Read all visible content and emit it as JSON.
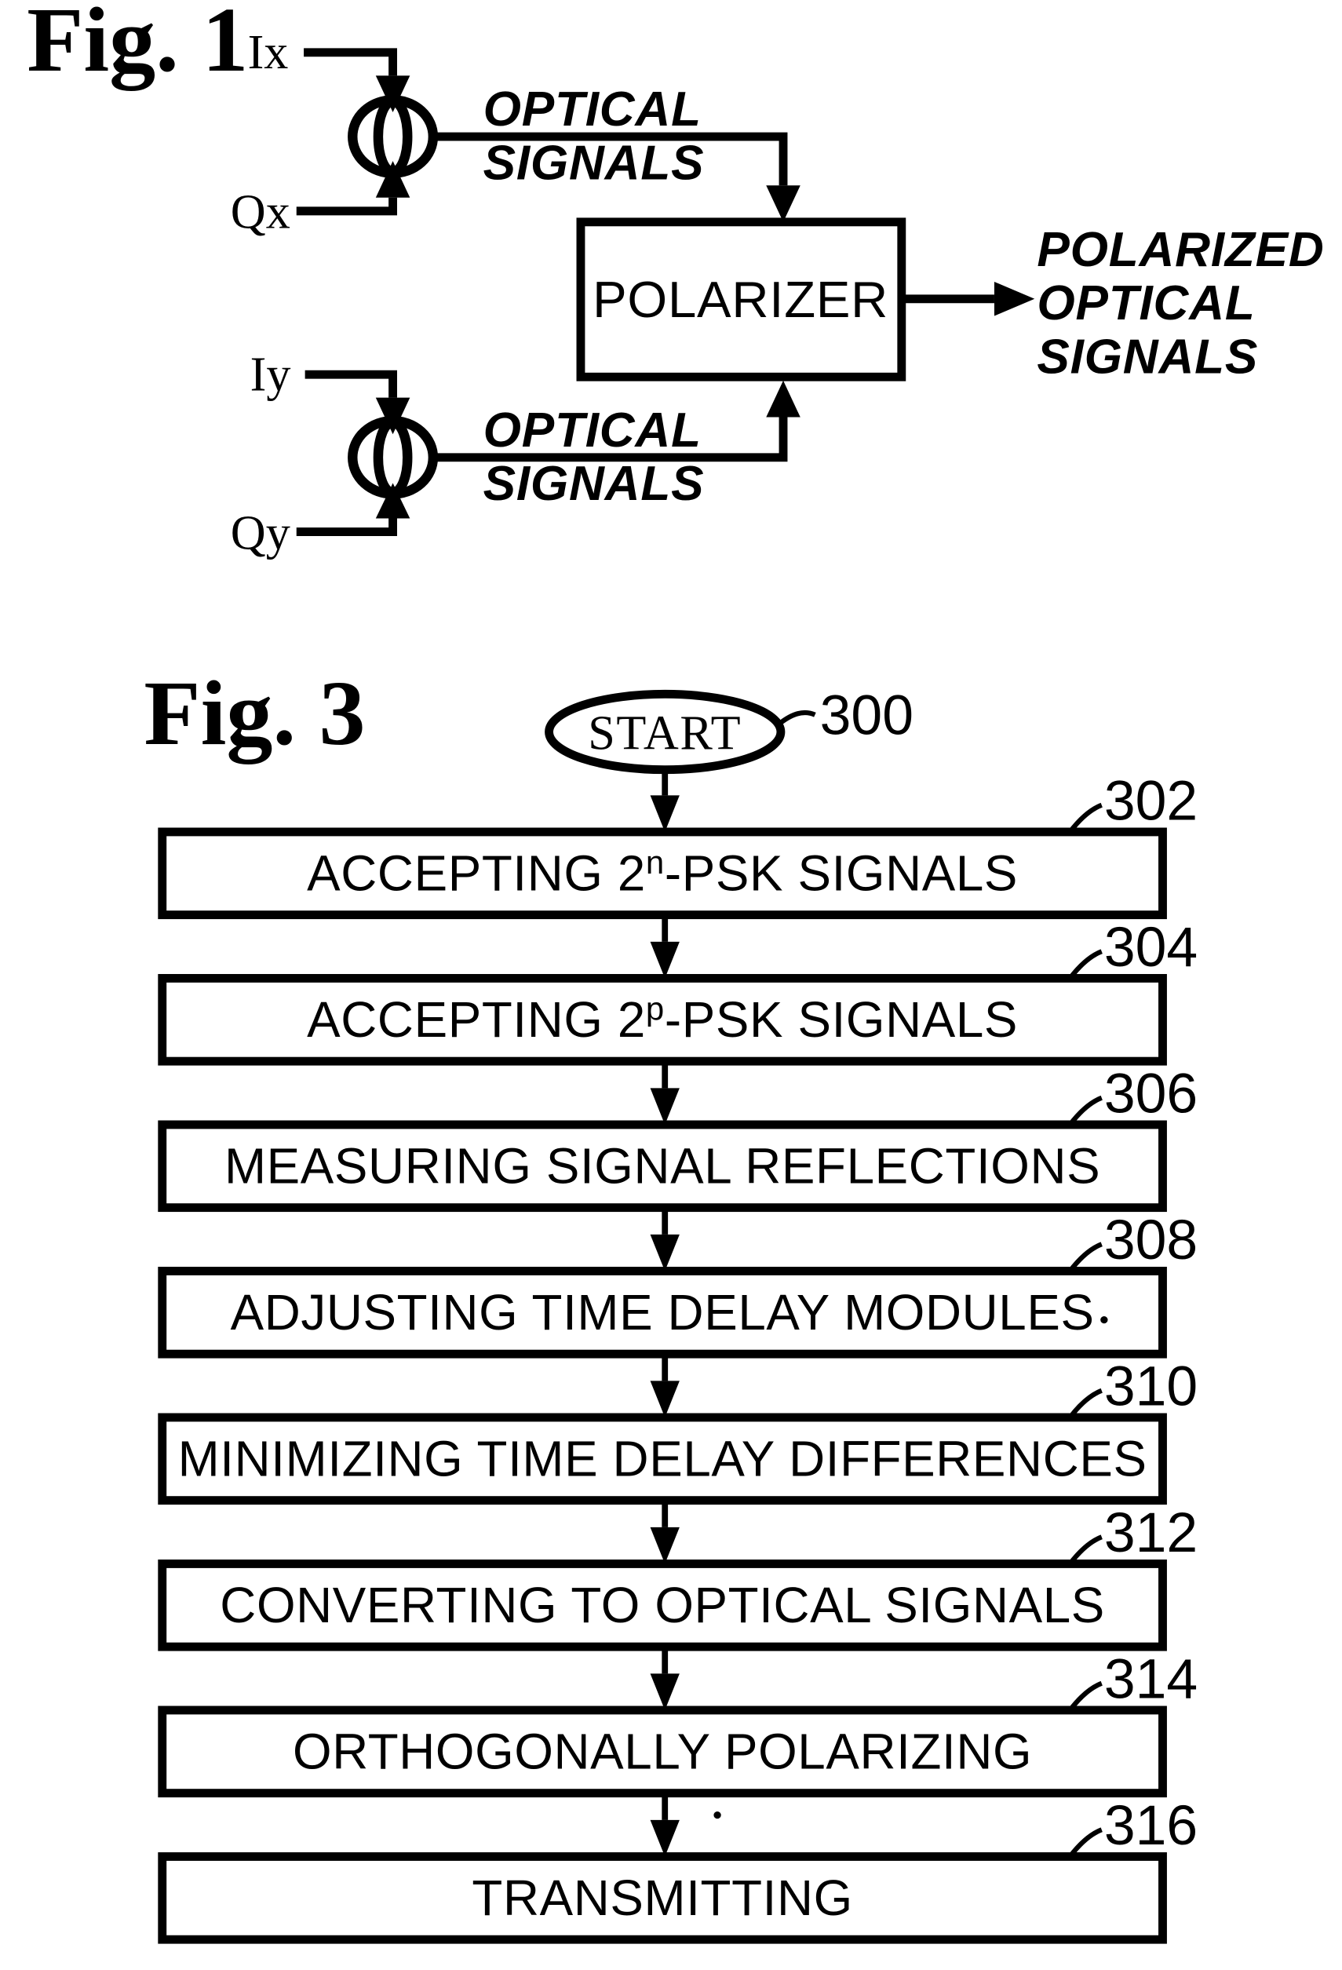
{
  "figure1": {
    "title": "Fig. 1",
    "inputs": {
      "ix": "Ix",
      "qx": "Qx",
      "iy": "Iy",
      "qy": "Qy"
    },
    "signal_label_x": {
      "line1": "OPTICAL",
      "line2": "SIGNALS"
    },
    "signal_label_y": {
      "line1": "OPTICAL",
      "line2": "SIGNALS"
    },
    "polarizer": "POLARIZER",
    "output_label": {
      "line1": "POLARIZED",
      "line2": "OPTICAL",
      "line3": "SIGNALS"
    },
    "modulator_icon_name": "optical-modulator-icon"
  },
  "figure3": {
    "title": "Fig. 3",
    "start": {
      "label": "START",
      "ref": "300"
    },
    "steps": [
      {
        "ref": "302",
        "text_pre": "ACCEPTING 2",
        "sup": "n",
        "text_post": "-PSK SIGNALS"
      },
      {
        "ref": "304",
        "text_pre": "ACCEPTING 2",
        "sup": "p",
        "text_post": "-PSK SIGNALS"
      },
      {
        "ref": "306",
        "text_pre": "MEASURING SIGNAL REFLECTIONS",
        "sup": "",
        "text_post": ""
      },
      {
        "ref": "308",
        "text_pre": "ADJUSTING TIME DELAY MODULES",
        "sup": "",
        "text_post": ""
      },
      {
        "ref": "310",
        "text_pre": "MINIMIZING TIME DELAY DIFFERENCES",
        "sup": "",
        "text_post": ""
      },
      {
        "ref": "312",
        "text_pre": "CONVERTING TO OPTICAL SIGNALS",
        "sup": "",
        "text_post": ""
      },
      {
        "ref": "314",
        "text_pre": "ORTHOGONALLY POLARIZING",
        "sup": "",
        "text_post": ""
      },
      {
        "ref": "316",
        "text_pre": "TRANSMITTING",
        "sup": "",
        "text_post": ""
      }
    ]
  },
  "colors": {
    "ink": "#000000",
    "paper": "#ffffff"
  }
}
